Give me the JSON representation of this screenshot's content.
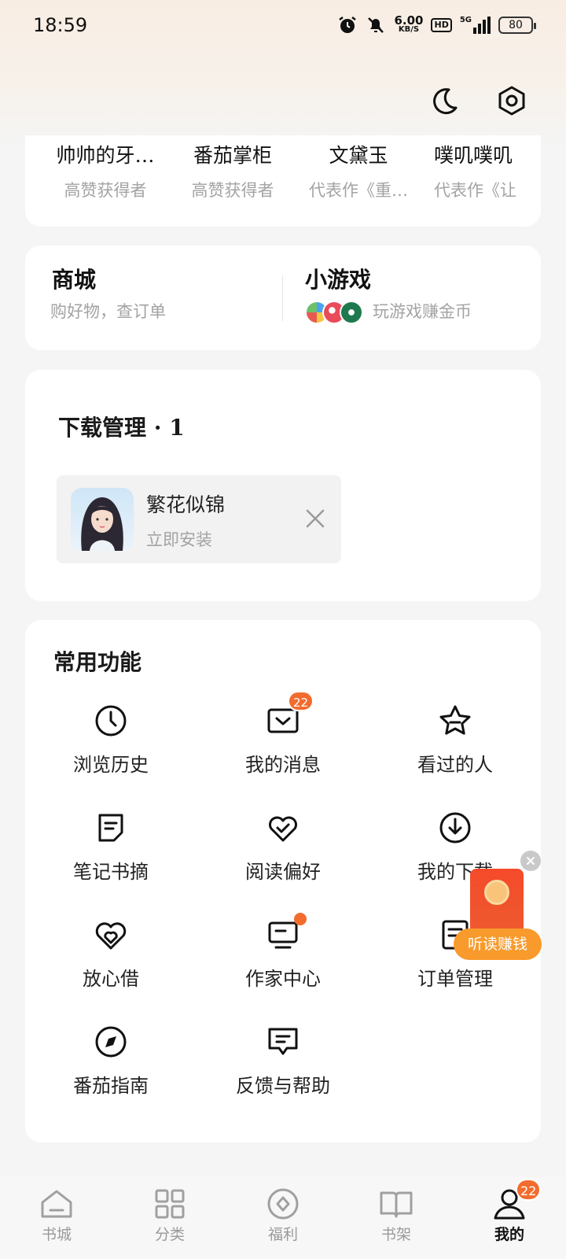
{
  "status_bar": {
    "time": "18:59",
    "net_speed": "6.00",
    "net_unit": "KB/S",
    "hd": "HD",
    "signal": "5G",
    "battery": "80"
  },
  "authors": [
    {
      "name": "帅帅的牙…",
      "sub": "高赞获得者"
    },
    {
      "name": "番茄掌柜",
      "sub": "高赞获得者"
    },
    {
      "name": "文黛玉",
      "sub": "代表作《重…"
    },
    {
      "name": "噗叽噗叽",
      "sub": "代表作《让"
    }
  ],
  "shop": {
    "title": "商城",
    "subtitle": "购好物，查订单"
  },
  "games": {
    "title": "小游戏",
    "subtitle": "玩游戏赚金币"
  },
  "downloads": {
    "title": "下载管理 · 1",
    "item": {
      "name": "繁花似锦",
      "action": "立即安装"
    }
  },
  "functions": {
    "title": "常用功能",
    "items": [
      {
        "label": "浏览历史",
        "icon": "clock-icon"
      },
      {
        "label": "我的消息",
        "icon": "message-icon",
        "badge": "22"
      },
      {
        "label": "看过的人",
        "icon": "star-icon"
      },
      {
        "label": "笔记书摘",
        "icon": "note-icon"
      },
      {
        "label": "阅读偏好",
        "icon": "heart-check-icon"
      },
      {
        "label": "我的下载",
        "icon": "download-icon"
      },
      {
        "label": "放心借",
        "icon": "hearts-icon"
      },
      {
        "label": "作家中心",
        "icon": "monitor-icon"
      },
      {
        "label": "订单管理",
        "icon": "order-icon"
      },
      {
        "label": "番茄指南",
        "icon": "compass-icon"
      },
      {
        "label": "反馈与帮助",
        "icon": "chat-icon"
      }
    ]
  },
  "floating": {
    "label": "听读赚钱"
  },
  "tabs": [
    {
      "label": "书城",
      "icon": "home-icon"
    },
    {
      "label": "分类",
      "icon": "grid-icon"
    },
    {
      "label": "福利",
      "icon": "coin-icon"
    },
    {
      "label": "书架",
      "icon": "book-icon"
    },
    {
      "label": "我的",
      "icon": "user-icon",
      "badge": "22",
      "active": true
    }
  ],
  "colors": {
    "accent": "#f26c2e",
    "background": "#f5f5f5",
    "card": "#ffffff",
    "muted_text": "#a3a3a3"
  }
}
